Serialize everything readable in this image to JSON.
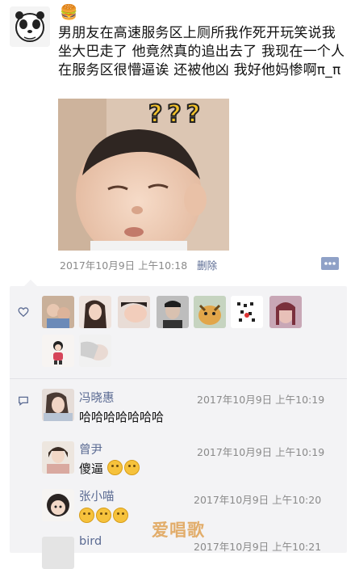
{
  "post": {
    "nickname_emoji": "🍔",
    "text": "男朋友在高速服务区上厕所我作死开玩笑说我坐大巴走了 他竟然真的追出去了 我现在一个人在服务区很懵逼诶 还被他凶 我好他妈惨啊π_π",
    "photo_marks": "???",
    "timestamp": "2017年10月9日 上午10:18",
    "delete_label": "删除"
  },
  "likes": {
    "count_shown": 10
  },
  "comments": [
    {
      "name": "冯晓惠",
      "text": "哈哈哈哈哈哈哈",
      "time": "2017年10月9日 上午10:19",
      "emojis": 0
    },
    {
      "name": "曾尹",
      "text": "傻逼",
      "time": "2017年10月9日 上午10:19",
      "emojis": 2
    },
    {
      "name": "张小喵",
      "text": "",
      "time": "2017年10月9日 上午10:20",
      "emojis": 3
    },
    {
      "name": "bird",
      "text": "",
      "time": "2017年10月9日 上午10:21",
      "emojis": 0
    }
  ],
  "watermark": "爱唱歌",
  "colors": {
    "link": "#5a6a92",
    "meta": "#8a8a8a",
    "box": "#f3f3f5"
  }
}
